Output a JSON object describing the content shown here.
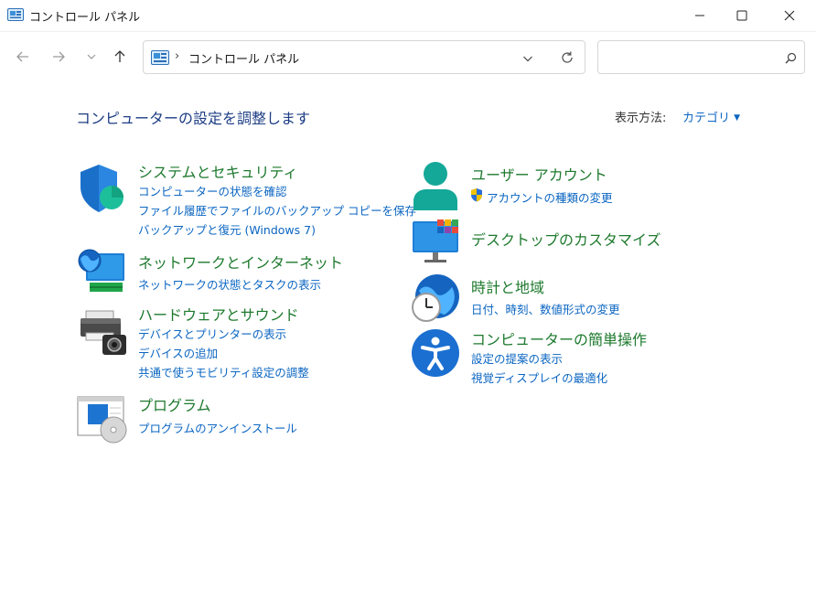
{
  "window": {
    "title": "コントロール パネル",
    "controls": {
      "minimize_icon": "minimize-icon",
      "maximize_icon": "maximize-icon",
      "close_icon": "close-icon"
    }
  },
  "nav": {
    "back_icon": "arrow-left-icon",
    "forward_icon": "arrow-right-icon",
    "recent_icon": "chevron-down-icon",
    "up_icon": "arrow-up-icon",
    "breadcrumb": [
      "コントロール パネル"
    ],
    "refresh_icon": "refresh-icon",
    "search_icon": "search-icon",
    "search_placeholder": ""
  },
  "main": {
    "heading": "コンピューターの設定を調整します",
    "view_by_label": "表示方法:",
    "view_by_value": "カテゴリ",
    "left": [
      {
        "icon": "security-shield-icon",
        "title": "システムとセキュリティ",
        "links": [
          "コンピューターの状態を確認",
          "ファイル履歴でファイルのバックアップ コピーを保存",
          "バックアップと復元 (Windows 7)"
        ]
      },
      {
        "icon": "network-globe-icon",
        "title": "ネットワークとインターネット",
        "links": [
          "ネットワークの状態とタスクの表示"
        ]
      },
      {
        "icon": "printer-camera-icon",
        "title": "ハードウェアとサウンド",
        "links": [
          "デバイスとプリンターの表示",
          "デバイスの追加",
          "共通で使うモビリティ設定の調整"
        ]
      },
      {
        "icon": "program-disc-icon",
        "title": "プログラム",
        "links": [
          "プログラムのアンインストール"
        ]
      }
    ],
    "right": [
      {
        "icon": "user-account-icon",
        "title": "ユーザー アカウント",
        "links": [
          "アカウントの種類の変更"
        ]
      },
      {
        "icon": "monitor-desktop-icon",
        "title": "デスクトップのカスタマイズ",
        "links": []
      },
      {
        "icon": "clock-globe-icon",
        "title": "時計と地域",
        "links": [
          "日付、時刻、数値形式の変更"
        ]
      },
      {
        "icon": "accessibility-icon",
        "title": "コンピューターの簡単操作",
        "links": [
          "設定の提案の表示",
          "視覚ディスプレイの最適化"
        ]
      }
    ]
  }
}
